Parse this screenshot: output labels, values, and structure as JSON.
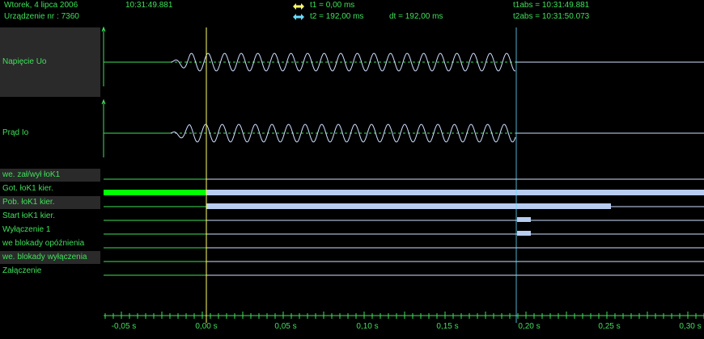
{
  "header": {
    "date": "Wtorek,  4  lipca  2006",
    "time": "10:31:49.881",
    "device": "Urządzenie nr :  7360",
    "t1": "t1 = 0,00 ms",
    "t2": "t2 = 192,00 ms",
    "dt": "dt = 192,00 ms",
    "t1abs": "t1abs = 10:31:49.881",
    "t2abs": "t2abs = 10:31:50.073"
  },
  "colors": {
    "accent": "#3ee05a",
    "t1_cursor": "#ffff66",
    "t2_cursor": "#66ddff",
    "trace": "#cfe0ff",
    "bar": "#b8ccf0",
    "bar_active": "#00ff00"
  },
  "analog_channels": [
    {
      "label": "Napięcie Uo"
    },
    {
      "label": "Prąd Io"
    }
  ],
  "digital_channels": [
    {
      "label": "we. zał/wył łoK1",
      "state": "off"
    },
    {
      "label": "Got. łoK1 kier.",
      "state": "on_from_start"
    },
    {
      "label": "Pob. łoK1 kier.",
      "state": "on_0_to_0.25"
    },
    {
      "label": "Start łoK1 kier.",
      "state": "pulse_at_0.192"
    },
    {
      "label": "Wyłączenie 1",
      "state": "pulse_at_0.192"
    },
    {
      "label": "we blokady opóźnienia",
      "state": "off"
    },
    {
      "label": "we. blokady wyłączenia",
      "state": "off"
    },
    {
      "label": "Załączenie",
      "state": "off"
    }
  ],
  "axis": {
    "ticks": [
      "-0,05 s",
      "0,00 s",
      "0,05 s",
      "0,10 s",
      "0,15 s",
      "0,20 s",
      "0,25 s",
      "0,30 s"
    ]
  }
}
